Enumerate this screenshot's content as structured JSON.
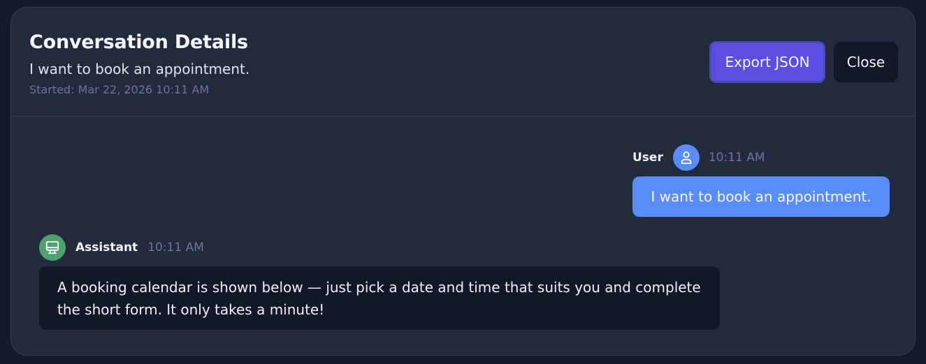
{
  "header": {
    "title": "Conversation Details",
    "subtitle": "I want to book an appointment.",
    "started": "Started: Mar 22, 2026 10:11 AM",
    "export_label": "Export JSON",
    "close_label": "Close"
  },
  "messages": {
    "user": {
      "sender": "User",
      "time": "10:11 AM",
      "text": "I want to book an appointment.",
      "icon": "user-icon"
    },
    "assistant": {
      "sender": "Assistant",
      "time": "10:11 AM",
      "text": "A booking calendar is shown below — just pick a date and time that suits you and complete the short form. It only takes a minute!",
      "icon": "monitor-icon"
    }
  },
  "colors": {
    "background": "#151a2d",
    "panel": "#222a3d",
    "accent": "#5a4fe0",
    "user_bubble": "#5a8cf8",
    "assistant_avatar": "#4fa26f",
    "assistant_bubble": "#131827"
  }
}
